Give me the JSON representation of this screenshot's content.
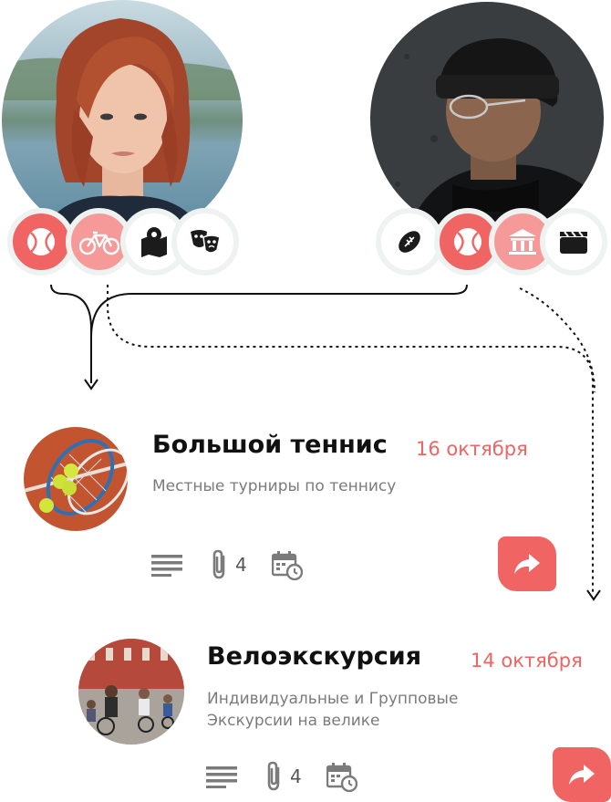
{
  "users": [
    {
      "avatar": "woman-red-hair-photo",
      "interests": [
        {
          "icon": "tennis-ball-icon",
          "style": "red"
        },
        {
          "icon": "bicycle-icon",
          "style": "pink"
        },
        {
          "icon": "map-pin-icon",
          "style": "plain"
        },
        {
          "icon": "theater-masks-icon",
          "style": "plain"
        }
      ]
    },
    {
      "avatar": "man-beanie-glasses-photo",
      "interests": [
        {
          "icon": "football-icon",
          "style": "plain"
        },
        {
          "icon": "tennis-ball-icon",
          "style": "red"
        },
        {
          "icon": "museum-icon",
          "style": "pink"
        },
        {
          "icon": "clapperboard-icon",
          "style": "plain"
        }
      ]
    }
  ],
  "events": [
    {
      "title": "Большой теннис",
      "date": "16 октября",
      "description": "Местные турниры по теннису",
      "attachments": "4",
      "thumbnail": "tennis-rackets-photo"
    },
    {
      "title": "Велоэкскурсия",
      "date": "14 октября",
      "description_line1": "Индивидуальные и Групповые",
      "description_line2": "Экскурсии на велике",
      "attachments": "4",
      "thumbnail": "cyclists-street-photo"
    }
  ],
  "colors": {
    "accent": "#f06463",
    "accent_light": "#f59a99",
    "chip_border": "#eef3f1",
    "muted_text": "#7b7b7b"
  }
}
